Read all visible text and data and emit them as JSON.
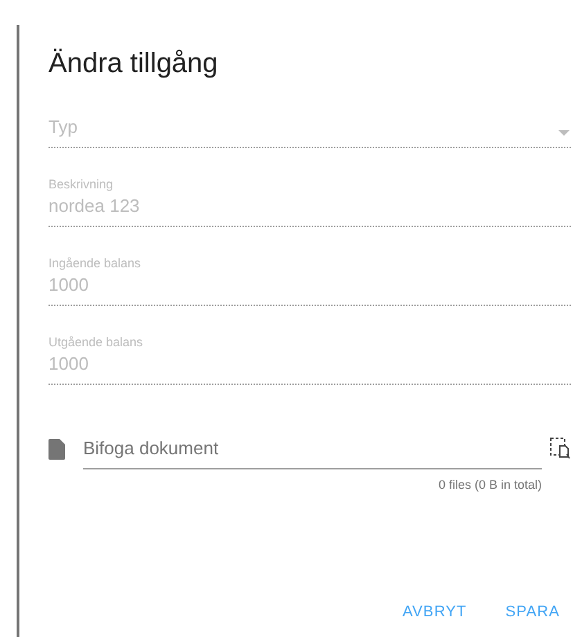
{
  "dialog": {
    "title": "Ändra tillgång"
  },
  "select": {
    "placeholder": "Typ",
    "disabled": true
  },
  "fields": [
    {
      "label": "Beskrivning",
      "value": "nordea 123",
      "disabled": true
    },
    {
      "label": "Ingående balans",
      "value": "1000",
      "disabled": true
    },
    {
      "label": "Utgående balans",
      "value": "1000",
      "disabled": true
    }
  ],
  "attachment": {
    "placeholder": "Bifoga dokument",
    "summary": "0 files (0 B in total)"
  },
  "buttons": [
    "AVBRYT",
    "SPARA"
  ]
}
